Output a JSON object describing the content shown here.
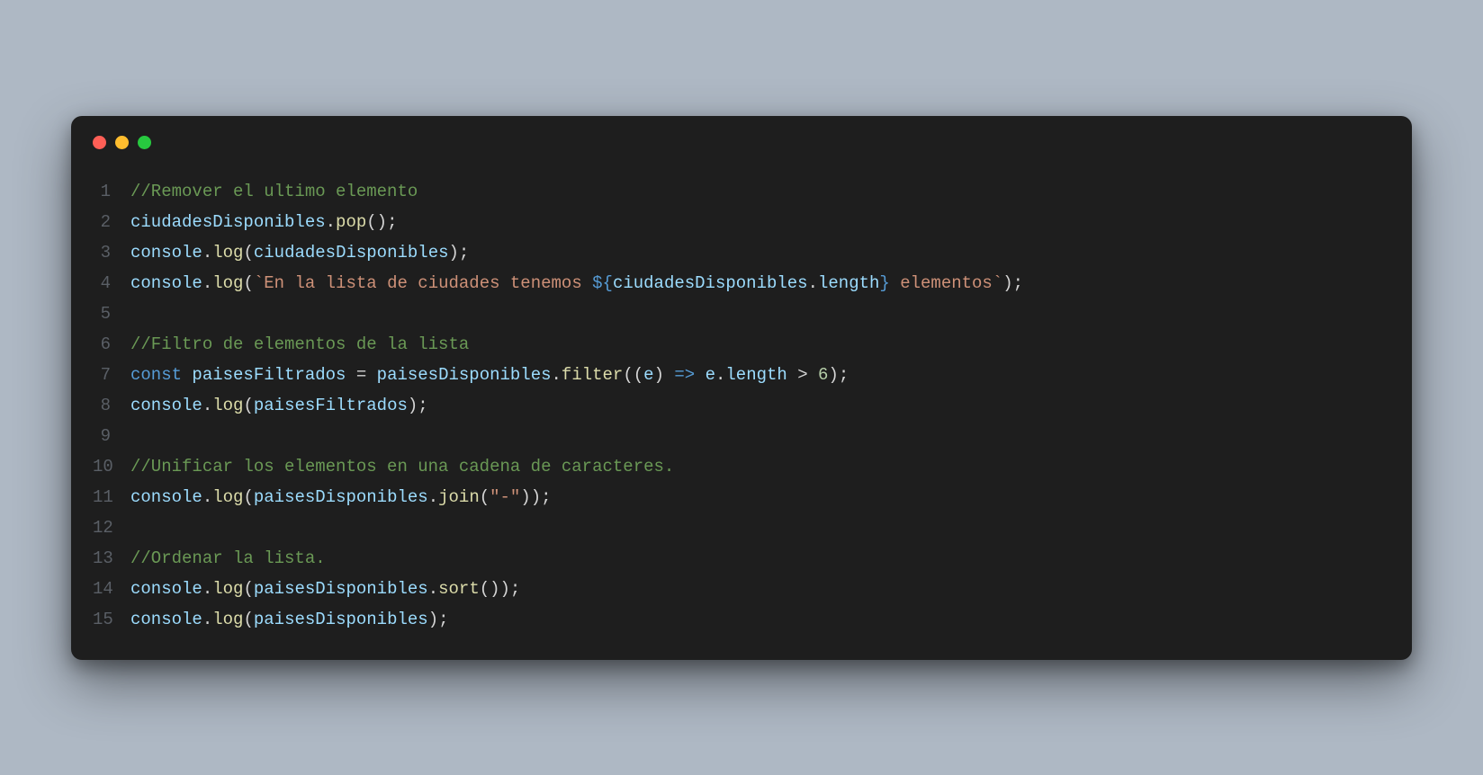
{
  "window": {
    "dots": [
      "red",
      "yellow",
      "green"
    ]
  },
  "code": {
    "lines": [
      {
        "n": "1",
        "tokens": [
          {
            "c": "tk-comment",
            "t": "//Remover el ultimo elemento"
          }
        ]
      },
      {
        "n": "2",
        "tokens": [
          {
            "c": "tk-ident",
            "t": "ciudadesDisponibles"
          },
          {
            "c": "tk-default",
            "t": "."
          },
          {
            "c": "tk-func",
            "t": "pop"
          },
          {
            "c": "tk-default",
            "t": "();"
          }
        ]
      },
      {
        "n": "3",
        "tokens": [
          {
            "c": "tk-ident",
            "t": "console"
          },
          {
            "c": "tk-default",
            "t": "."
          },
          {
            "c": "tk-func",
            "t": "log"
          },
          {
            "c": "tk-default",
            "t": "("
          },
          {
            "c": "tk-ident",
            "t": "ciudadesDisponibles"
          },
          {
            "c": "tk-default",
            "t": ");"
          }
        ]
      },
      {
        "n": "4",
        "tokens": [
          {
            "c": "tk-ident",
            "t": "console"
          },
          {
            "c": "tk-default",
            "t": "."
          },
          {
            "c": "tk-func",
            "t": "log"
          },
          {
            "c": "tk-default",
            "t": "("
          },
          {
            "c": "tk-string",
            "t": "`En la lista de ciudades tenemos "
          },
          {
            "c": "tk-interp",
            "t": "${"
          },
          {
            "c": "tk-ident",
            "t": "ciudadesDisponibles"
          },
          {
            "c": "tk-default",
            "t": "."
          },
          {
            "c": "tk-ident",
            "t": "length"
          },
          {
            "c": "tk-interp",
            "t": "}"
          },
          {
            "c": "tk-string",
            "t": " elementos`"
          },
          {
            "c": "tk-default",
            "t": ");"
          }
        ]
      },
      {
        "n": "5",
        "tokens": [
          {
            "c": "tk-default",
            "t": ""
          }
        ]
      },
      {
        "n": "6",
        "tokens": [
          {
            "c": "tk-comment",
            "t": "//Filtro de elementos de la lista"
          }
        ]
      },
      {
        "n": "7",
        "tokens": [
          {
            "c": "tk-keyword",
            "t": "const"
          },
          {
            "c": "tk-default",
            "t": " "
          },
          {
            "c": "tk-ident",
            "t": "paisesFiltrados"
          },
          {
            "c": "tk-default",
            "t": " = "
          },
          {
            "c": "tk-ident",
            "t": "paisesDisponibles"
          },
          {
            "c": "tk-default",
            "t": "."
          },
          {
            "c": "tk-func",
            "t": "filter"
          },
          {
            "c": "tk-default",
            "t": "(("
          },
          {
            "c": "tk-ident",
            "t": "e"
          },
          {
            "c": "tk-default",
            "t": ") "
          },
          {
            "c": "tk-keyword",
            "t": "=>"
          },
          {
            "c": "tk-default",
            "t": " "
          },
          {
            "c": "tk-ident",
            "t": "e"
          },
          {
            "c": "tk-default",
            "t": "."
          },
          {
            "c": "tk-ident",
            "t": "length"
          },
          {
            "c": "tk-default",
            "t": " > "
          },
          {
            "c": "tk-number",
            "t": "6"
          },
          {
            "c": "tk-default",
            "t": ");"
          }
        ]
      },
      {
        "n": "8",
        "tokens": [
          {
            "c": "tk-ident",
            "t": "console"
          },
          {
            "c": "tk-default",
            "t": "."
          },
          {
            "c": "tk-func",
            "t": "log"
          },
          {
            "c": "tk-default",
            "t": "("
          },
          {
            "c": "tk-ident",
            "t": "paisesFiltrados"
          },
          {
            "c": "tk-default",
            "t": ");"
          }
        ]
      },
      {
        "n": "9",
        "tokens": [
          {
            "c": "tk-default",
            "t": ""
          }
        ]
      },
      {
        "n": "10",
        "tokens": [
          {
            "c": "tk-comment",
            "t": "//Unificar los elementos en una cadena de caracteres."
          }
        ]
      },
      {
        "n": "11",
        "tokens": [
          {
            "c": "tk-ident",
            "t": "console"
          },
          {
            "c": "tk-default",
            "t": "."
          },
          {
            "c": "tk-func",
            "t": "log"
          },
          {
            "c": "tk-default",
            "t": "("
          },
          {
            "c": "tk-ident",
            "t": "paisesDisponibles"
          },
          {
            "c": "tk-default",
            "t": "."
          },
          {
            "c": "tk-func",
            "t": "join"
          },
          {
            "c": "tk-default",
            "t": "("
          },
          {
            "c": "tk-string",
            "t": "\"-\""
          },
          {
            "c": "tk-default",
            "t": "));"
          }
        ]
      },
      {
        "n": "12",
        "tokens": [
          {
            "c": "tk-default",
            "t": ""
          }
        ]
      },
      {
        "n": "13",
        "tokens": [
          {
            "c": "tk-comment",
            "t": "//Ordenar la lista."
          }
        ]
      },
      {
        "n": "14",
        "tokens": [
          {
            "c": "tk-ident",
            "t": "console"
          },
          {
            "c": "tk-default",
            "t": "."
          },
          {
            "c": "tk-func",
            "t": "log"
          },
          {
            "c": "tk-default",
            "t": "("
          },
          {
            "c": "tk-ident",
            "t": "paisesDisponibles"
          },
          {
            "c": "tk-default",
            "t": "."
          },
          {
            "c": "tk-func",
            "t": "sort"
          },
          {
            "c": "tk-default",
            "t": "());"
          }
        ]
      },
      {
        "n": "15",
        "tokens": [
          {
            "c": "tk-ident",
            "t": "console"
          },
          {
            "c": "tk-default",
            "t": "."
          },
          {
            "c": "tk-func",
            "t": "log"
          },
          {
            "c": "tk-default",
            "t": "("
          },
          {
            "c": "tk-ident",
            "t": "paisesDisponibles"
          },
          {
            "c": "tk-default",
            "t": ");"
          }
        ]
      }
    ]
  }
}
